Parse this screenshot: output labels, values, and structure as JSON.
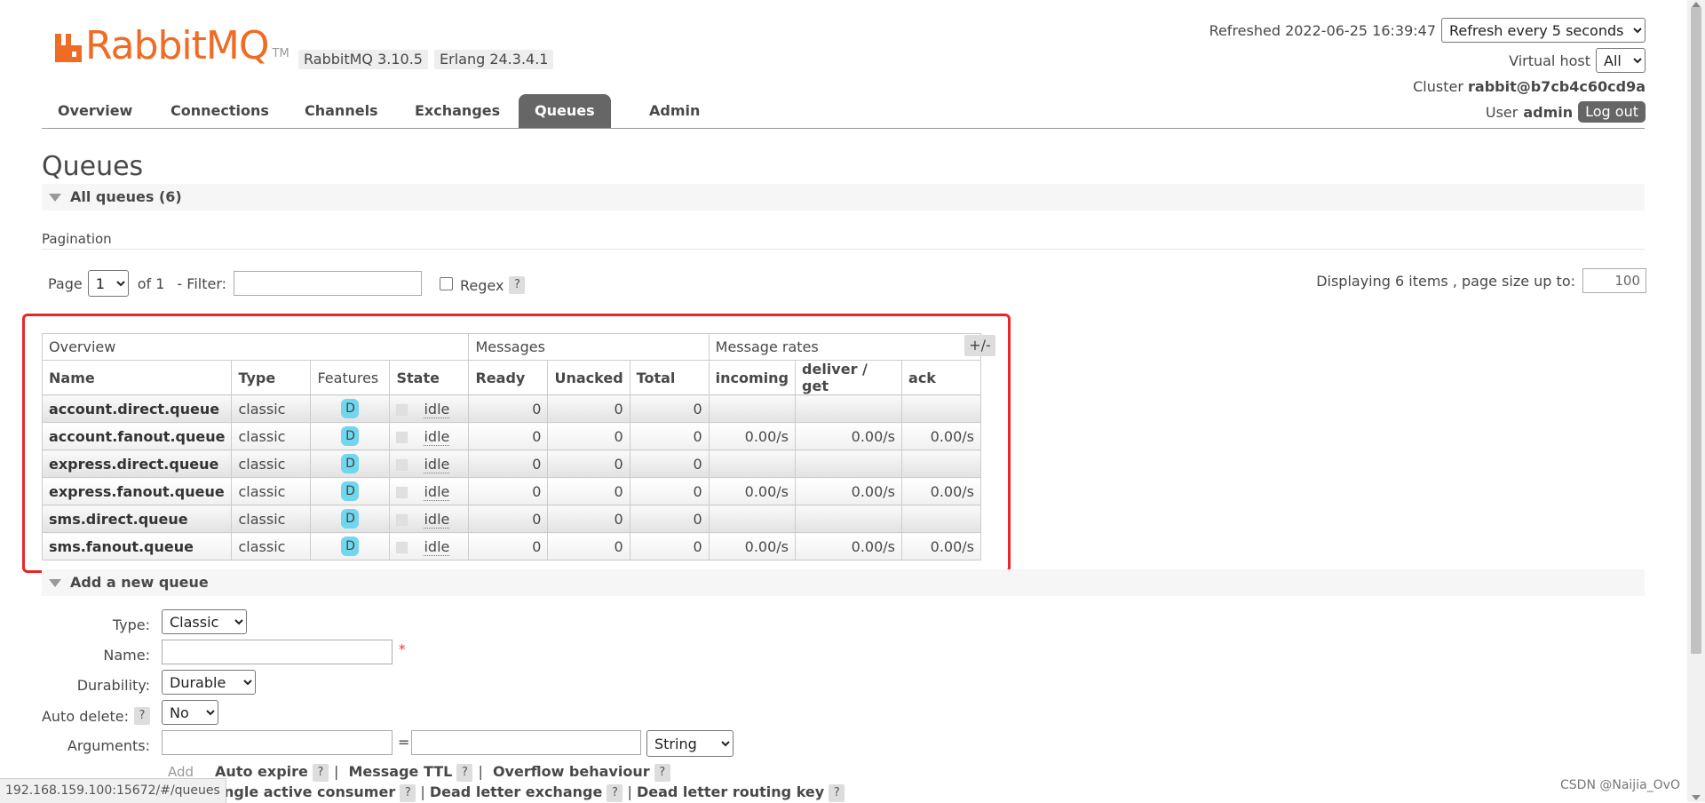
{
  "header": {
    "logo_text": "RabbitMQ",
    "logo_tm": "TM",
    "version_rabbitmq": "RabbitMQ 3.10.5",
    "version_erlang": "Erlang 24.3.4.1",
    "refreshed": "Refreshed 2022-06-25 16:39:47",
    "refresh_select": "Refresh every 5 seconds",
    "virtual_host_label": "Virtual host",
    "virtual_host_value": "All",
    "cluster_label": "Cluster",
    "cluster_value": "rabbit@b7cb4c60cd9a",
    "user_label": "User",
    "user_value": "admin",
    "logout_label": "Log out",
    "brand_color": "#f06c24"
  },
  "tabs": [
    {
      "label": "Overview",
      "active": false
    },
    {
      "label": "Connections",
      "active": false
    },
    {
      "label": "Channels",
      "active": false
    },
    {
      "label": "Exchanges",
      "active": false
    },
    {
      "label": "Queues",
      "active": true
    },
    {
      "label": "Admin",
      "active": false
    }
  ],
  "page_title": "Queues",
  "all_queues_section": "All queues (6)",
  "pagination": {
    "label": "Pagination",
    "page_label": "Page",
    "page_value": "1",
    "of_label": "of 1",
    "filter_label": "- Filter:",
    "filter_value": "",
    "regex_label": "Regex",
    "help": "?",
    "display_info": "Displaying 6 items , page size up to:",
    "page_size": "100"
  },
  "table": {
    "group_headers": [
      "Overview",
      "Messages",
      "Message rates"
    ],
    "columns": [
      "Name",
      "Type",
      "Features",
      "State",
      "Ready",
      "Unacked",
      "Total",
      "incoming",
      "deliver / get",
      "ack"
    ],
    "toggle": "+/-",
    "rows": [
      {
        "name": "account.direct.queue",
        "type": "classic",
        "feature": "D",
        "state": "idle",
        "ready": "0",
        "unacked": "0",
        "total": "0",
        "incoming": "",
        "deliver": "",
        "ack": ""
      },
      {
        "name": "account.fanout.queue",
        "type": "classic",
        "feature": "D",
        "state": "idle",
        "ready": "0",
        "unacked": "0",
        "total": "0",
        "incoming": "0.00/s",
        "deliver": "0.00/s",
        "ack": "0.00/s"
      },
      {
        "name": "express.direct.queue",
        "type": "classic",
        "feature": "D",
        "state": "idle",
        "ready": "0",
        "unacked": "0",
        "total": "0",
        "incoming": "",
        "deliver": "",
        "ack": ""
      },
      {
        "name": "express.fanout.queue",
        "type": "classic",
        "feature": "D",
        "state": "idle",
        "ready": "0",
        "unacked": "0",
        "total": "0",
        "incoming": "0.00/s",
        "deliver": "0.00/s",
        "ack": "0.00/s"
      },
      {
        "name": "sms.direct.queue",
        "type": "classic",
        "feature": "D",
        "state": "idle",
        "ready": "0",
        "unacked": "0",
        "total": "0",
        "incoming": "",
        "deliver": "",
        "ack": ""
      },
      {
        "name": "sms.fanout.queue",
        "type": "classic",
        "feature": "D",
        "state": "idle",
        "ready": "0",
        "unacked": "0",
        "total": "0",
        "incoming": "0.00/s",
        "deliver": "0.00/s",
        "ack": "0.00/s"
      }
    ]
  },
  "add_queue": {
    "section": "Add a new queue",
    "type_label": "Type:",
    "type_value": "Classic",
    "name_label": "Name:",
    "name_value": "",
    "required": "*",
    "durability_label": "Durability:",
    "durability_value": "Durable",
    "auto_delete_label": "Auto delete:",
    "auto_delete_value": "No",
    "arguments_label": "Arguments:",
    "equals": "=",
    "arg_type_value": "String",
    "add_label": "Add",
    "arg_links_row1": [
      "Auto expire",
      "Message TTL",
      "Overflow behaviour"
    ],
    "arg_links_row2": [
      "Single active consumer",
      "Dead letter exchange",
      "Dead letter routing key"
    ]
  },
  "status_url": "192.168.159.100:15672/#/queues",
  "watermark": "CSDN @Naijia_OvO",
  "colors": {
    "highlight_border": "#e8262a",
    "active_tab": "#666666",
    "feature_badge": "#70d7ee"
  },
  "icons": [
    "rabbitmq-logo-icon",
    "collapse-triangle-icon",
    "scroll-up-icon",
    "scroll-down-icon"
  ]
}
